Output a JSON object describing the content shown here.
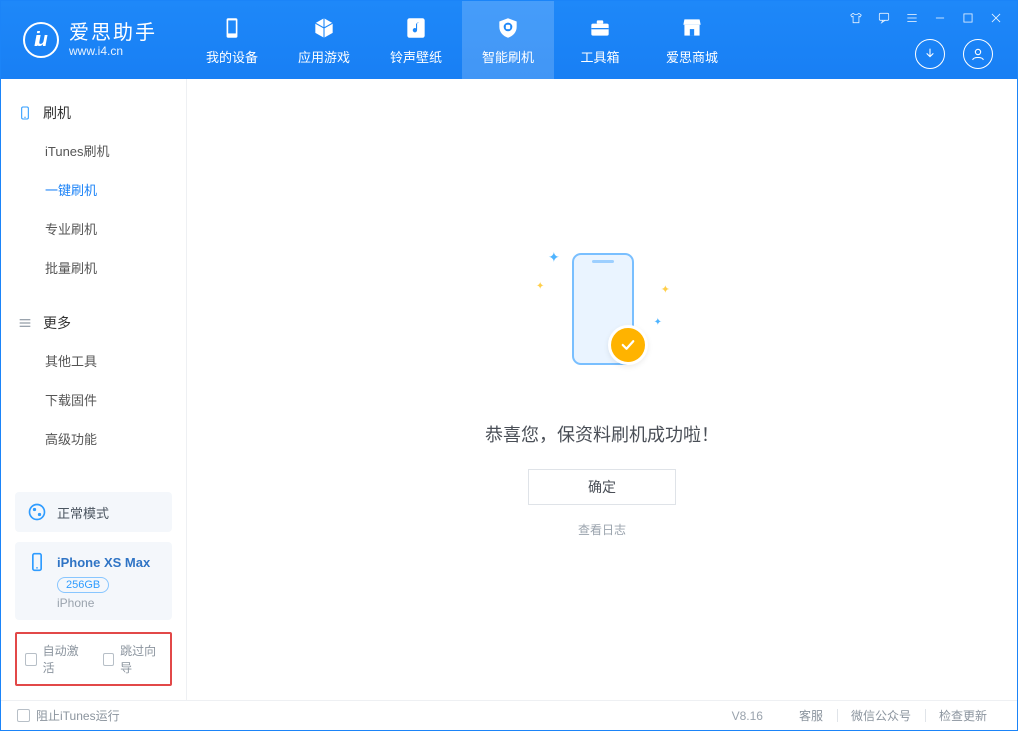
{
  "brand": {
    "cn": "爱思助手",
    "url": "www.i4.cn"
  },
  "nav": [
    {
      "label": "我的设备",
      "icon": "phone"
    },
    {
      "label": "应用游戏",
      "icon": "cube"
    },
    {
      "label": "铃声壁纸",
      "icon": "music"
    },
    {
      "label": "智能刷机",
      "icon": "shield",
      "active": true
    },
    {
      "label": "工具箱",
      "icon": "briefcase"
    },
    {
      "label": "爱思商城",
      "icon": "shop"
    }
  ],
  "sidebar": {
    "sections": [
      {
        "title": "刷机",
        "icon": "phone-outline",
        "items": [
          "iTunes刷机",
          "一键刷机",
          "专业刷机",
          "批量刷机"
        ],
        "activeIndex": 1
      },
      {
        "title": "更多",
        "icon": "hamburger",
        "items": [
          "其他工具",
          "下载固件",
          "高级功能"
        ],
        "activeIndex": -1
      }
    ],
    "mode_card": {
      "label": "正常模式"
    },
    "device_card": {
      "name": "iPhone XS Max",
      "capacity": "256GB",
      "subtitle": "iPhone"
    },
    "options": {
      "auto_activate": "自动激活",
      "skip_guide": "跳过向导"
    }
  },
  "main": {
    "headline": "恭喜您，保资料刷机成功啦！",
    "confirm": "确定",
    "log_link": "查看日志"
  },
  "status": {
    "block_itunes": "阻止iTunes运行",
    "version": "V8.16",
    "links": [
      "客服",
      "微信公众号",
      "检查更新"
    ]
  }
}
